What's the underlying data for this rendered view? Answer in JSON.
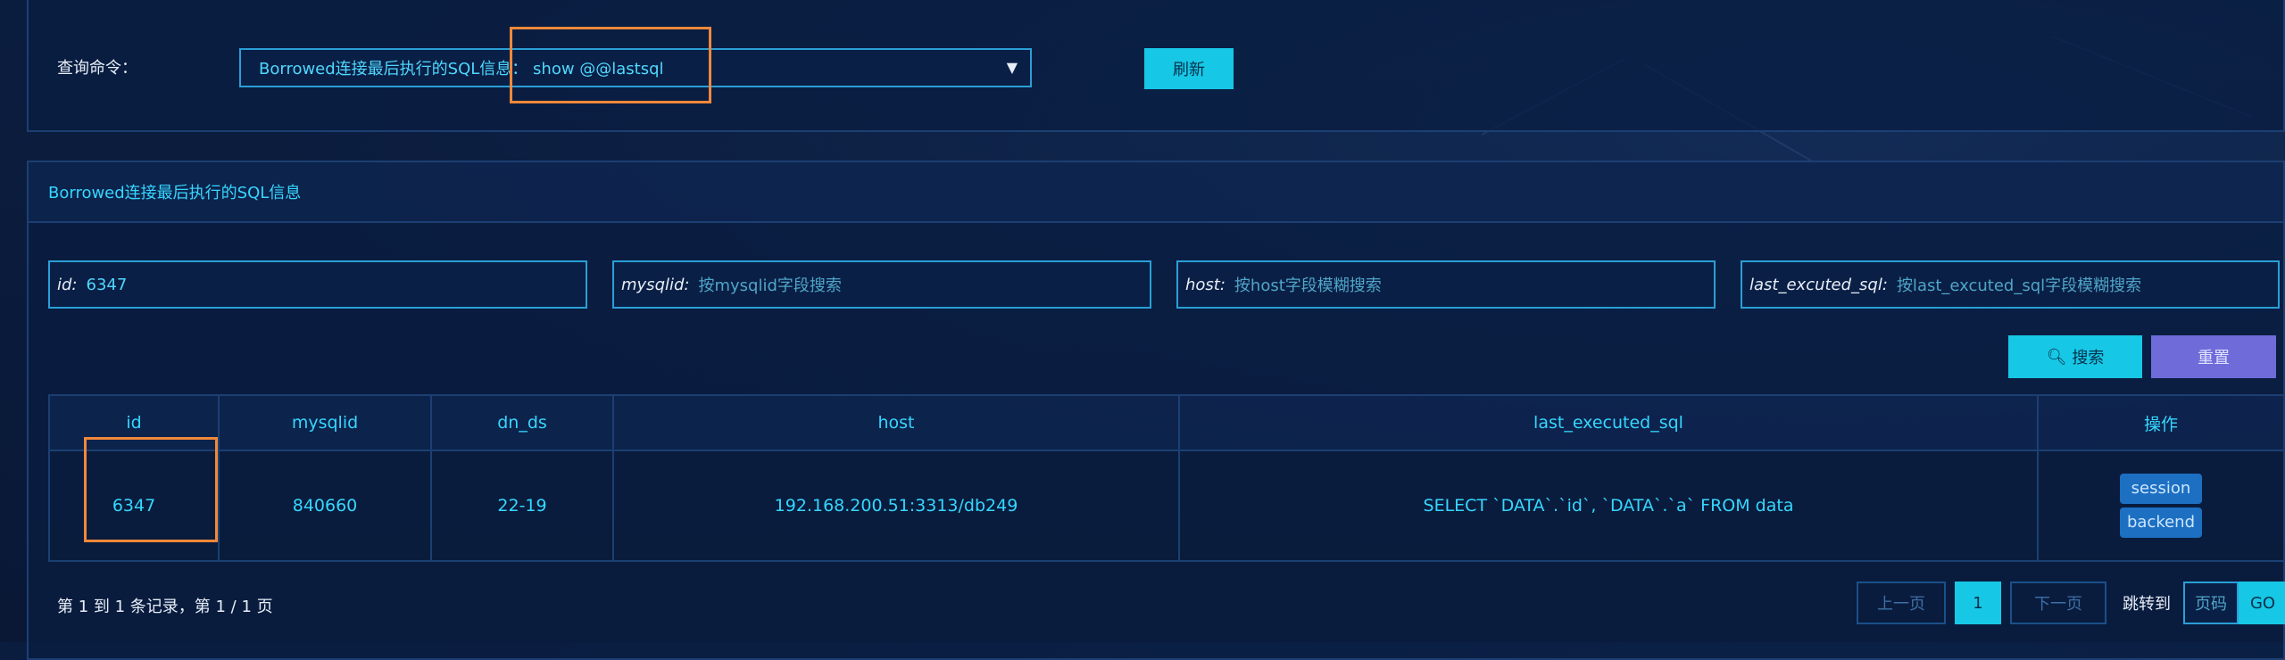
{
  "query": {
    "label": "查询命令：",
    "selected": "Borrowed连接最后执行的SQL信息：  show @@lastsql",
    "refresh_label": "刷新"
  },
  "table_panel": {
    "title": "Borrowed连接最后执行的SQL信息"
  },
  "filters": [
    {
      "label": "id:",
      "value": "6347",
      "placeholder": ""
    },
    {
      "label": "mysqlid:",
      "value": "",
      "placeholder": "按mysqlid字段搜索"
    },
    {
      "label": "host:",
      "value": "",
      "placeholder": "按host字段模糊搜索"
    },
    {
      "label": "last_excuted_sql:",
      "value": "",
      "placeholder": "按last_excuted_sql字段模糊搜索"
    }
  ],
  "buttons": {
    "search": "搜索",
    "reset": "重置"
  },
  "table": {
    "headers": [
      "id",
      "mysqlid",
      "dn_ds",
      "host",
      "last_executed_sql",
      "操作"
    ],
    "rows": [
      {
        "id": "6347",
        "mysqlid": "840660",
        "dn_ds": "22-19",
        "host": "192.168.200.51:3313/db249",
        "last_executed_sql": "SELECT `DATA`.`id`, `DATA`.`a` FROM data",
        "ops": [
          "session",
          "backend"
        ]
      }
    ]
  },
  "footer": {
    "summary": "第 1 到 1 条记录，第 1 / 1 页",
    "prev": "上一页",
    "page": "1",
    "next": "下一页",
    "jump": "跳转到",
    "page_placeholder": "页码",
    "go": "GO"
  },
  "colors": {
    "accent": "#17c7e6",
    "highlight": "#f0883a",
    "reset": "#6f6bd9"
  }
}
